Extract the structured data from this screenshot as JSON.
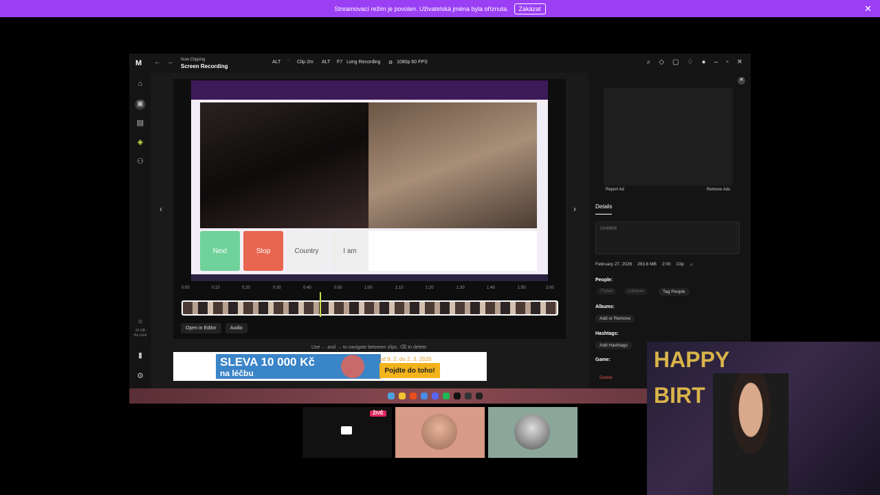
{
  "banner": {
    "text": "Streamovací režim je povolen. Uživatelská jména byla oříznuta.",
    "button": "Zakázat",
    "close": "✕"
  },
  "app": {
    "logo": "M",
    "now_label": "Now Clipping",
    "mode": "Screen Recording",
    "hotkey1_mod": "ALT",
    "hotkey1_key": "`",
    "hotkey1_label": "Clip 2m",
    "hotkey2_mod": "ALT",
    "hotkey2_key": "F7",
    "hotkey2_label": "Long Recording",
    "quality": "1080p 60 FPS"
  },
  "panel": {
    "report_ad": "Report Ad",
    "remove_ads": "Remove Ads",
    "details_tab": "Details",
    "title_placeholder": "Untitled",
    "date": "February 27, 2026",
    "size": "293.6 MB",
    "duration": "2:00",
    "clip_tag": "Clip",
    "people_label": "People:",
    "person1": "Thyten",
    "person2": "Lotoksen",
    "tag_people": "Tag People",
    "albums_label": "Albums:",
    "add_remove": "Add or Remove",
    "hashtags_label": "Hashtags:",
    "add_hashtags": "Add Hashtags",
    "game_label": "Game:",
    "delete": "Delete"
  },
  "player": {
    "buttons": {
      "next": "Next",
      "stop": "Stop",
      "country": "Country",
      "iam": "I am"
    },
    "ticks": [
      "0:00",
      "0:10",
      "0:20",
      "0:30",
      "0:40",
      "0:50",
      "1:00",
      "1:10",
      "1:20",
      "1:30",
      "1:40",
      "1:50",
      "2:00"
    ],
    "open_editor": "Open in Editor",
    "audio": "Audio",
    "hint": "Use ← and → to navigate between clips. ⌫ to delete."
  },
  "ad": {
    "headline": "SLEVA 10 000 Kč",
    "sub": "na léčbu",
    "dates": "od 9. 2. do 2. 3. 2026",
    "cta": "Pojdte do toho!"
  },
  "tiles": {
    "live_badge": "ŽIVĚ"
  },
  "webcam": {
    "happy": "HAPPY",
    "birt": "BIRT"
  },
  "sidebar_storage": {
    "size": "24 GB",
    "label": "No Limit"
  },
  "colors": {
    "banner": "#9b3ff5",
    "accent": "#c9e34a"
  }
}
